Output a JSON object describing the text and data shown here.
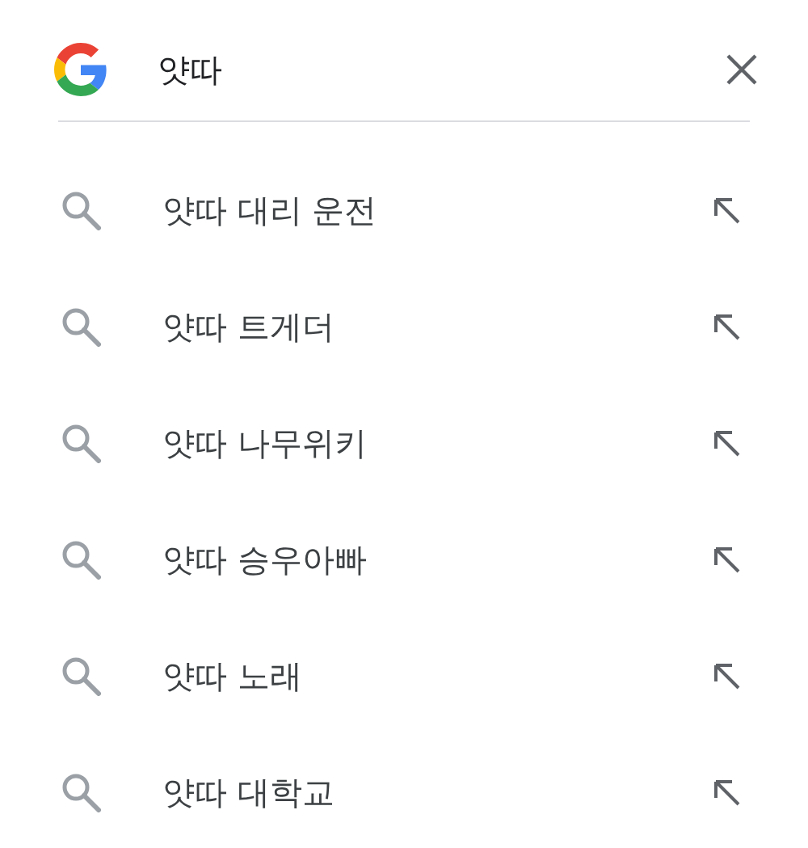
{
  "search": {
    "value": "얏따"
  },
  "suggestions": [
    {
      "text": "얏따 대리 운전"
    },
    {
      "text": "얏따 트게더"
    },
    {
      "text": "얏따 나무위키"
    },
    {
      "text": "얏따 승우아빠"
    },
    {
      "text": "얏따 노래"
    },
    {
      "text": "얏따 대학교"
    }
  ]
}
